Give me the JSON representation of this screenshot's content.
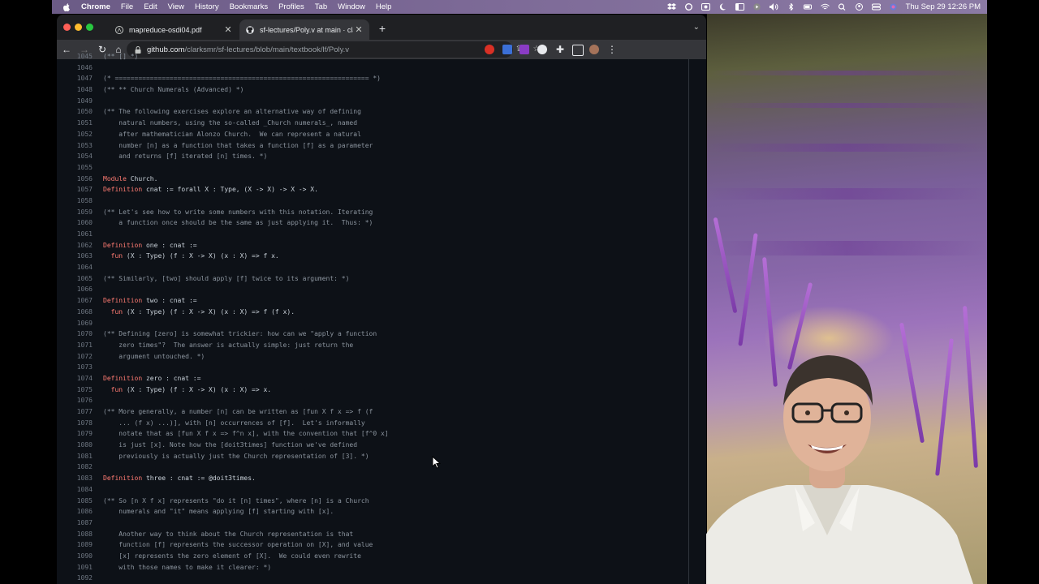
{
  "menubar": {
    "app": "Chrome",
    "items": [
      "File",
      "Edit",
      "View",
      "History",
      "Bookmarks",
      "Profiles",
      "Tab",
      "Window",
      "Help"
    ],
    "clock": "Thu Sep 29  12:26 PM"
  },
  "tabs": [
    {
      "title": "mapreduce-osdi04.pdf",
      "icon": "pdf-icon"
    },
    {
      "title": "sf-lectures/Poly.v at main · cla",
      "icon": "github-icon"
    }
  ],
  "address": {
    "host": "github.com",
    "path": "/clarksmr/sf-lectures/blob/main/textbook/lf/Poly.v"
  },
  "code": {
    "lines": [
      {
        "n": "1045",
        "t": "(** [] *)",
        "c": true
      },
      {
        "n": "1046",
        "t": ""
      },
      {
        "n": "1047",
        "t": "(* ================================================================= *)",
        "c": true
      },
      {
        "n": "1048",
        "t": "(** ** Church Numerals (Advanced) *)",
        "c": true
      },
      {
        "n": "1049",
        "t": ""
      },
      {
        "n": "1050",
        "t": "(** The following exercises explore an alternative way of defining",
        "c": true
      },
      {
        "n": "1051",
        "t": "    natural numbers, using the so-called _Church numerals_, named",
        "c": true
      },
      {
        "n": "1052",
        "t": "    after mathematician Alonzo Church.  We can represent a natural",
        "c": true
      },
      {
        "n": "1053",
        "t": "    number [n] as a function that takes a function [f] as a parameter",
        "c": true
      },
      {
        "n": "1054",
        "t": "    and returns [f] iterated [n] times. *)",
        "c": true
      },
      {
        "n": "1055",
        "t": ""
      },
      {
        "n": "1056",
        "k": "Module",
        "t": " Church."
      },
      {
        "n": "1057",
        "k": "Definition",
        "t": " cnat := forall X : Type, (X -> X) -> X -> X."
      },
      {
        "n": "1058",
        "t": ""
      },
      {
        "n": "1059",
        "t": "(** Let's see how to write some numbers with this notation. Iterating",
        "c": true
      },
      {
        "n": "1060",
        "t": "    a function once should be the same as just applying it.  Thus: *)",
        "c": true
      },
      {
        "n": "1061",
        "t": ""
      },
      {
        "n": "1062",
        "k": "Definition",
        "t": " one : cnat :="
      },
      {
        "n": "1063",
        "p": "  ",
        "k": "fun",
        "t": " (X : Type) (f : X -> X) (x : X) => f x."
      },
      {
        "n": "1064",
        "t": ""
      },
      {
        "n": "1065",
        "t": "(** Similarly, [two] should apply [f] twice to its argument: *)",
        "c": true
      },
      {
        "n": "1066",
        "t": ""
      },
      {
        "n": "1067",
        "k": "Definition",
        "t": " two : cnat :="
      },
      {
        "n": "1068",
        "p": "  ",
        "k": "fun",
        "t": " (X : Type) (f : X -> X) (x : X) => f (f x)."
      },
      {
        "n": "1069",
        "t": ""
      },
      {
        "n": "1070",
        "t": "(** Defining [zero] is somewhat trickier: how can we \"apply a function",
        "c": true
      },
      {
        "n": "1071",
        "t": "    zero times\"?  The answer is actually simple: just return the",
        "c": true
      },
      {
        "n": "1072",
        "t": "    argument untouched. *)",
        "c": true
      },
      {
        "n": "1073",
        "t": ""
      },
      {
        "n": "1074",
        "k": "Definition",
        "t": " zero : cnat :="
      },
      {
        "n": "1075",
        "p": "  ",
        "k": "fun",
        "t": " (X : Type) (f : X -> X) (x : X) => x."
      },
      {
        "n": "1076",
        "t": ""
      },
      {
        "n": "1077",
        "t": "(** More generally, a number [n] can be written as [fun X f x => f (f",
        "c": true
      },
      {
        "n": "1078",
        "t": "    ... (f x) ...)], with [n] occurrences of [f].  Let's informally",
        "c": true
      },
      {
        "n": "1079",
        "t": "    notate that as [fun X f x => f^n x], with the convention that [f^0 x]",
        "c": true
      },
      {
        "n": "1080",
        "t": "    is just [x]. Note how the [doit3times] function we've defined",
        "c": true
      },
      {
        "n": "1081",
        "t": "    previously is actually just the Church representation of [3]. *)",
        "c": true
      },
      {
        "n": "1082",
        "t": ""
      },
      {
        "n": "1083",
        "k": "Definition",
        "t": " three : cnat := @doit3times."
      },
      {
        "n": "1084",
        "t": ""
      },
      {
        "n": "1085",
        "t": "(** So [n X f x] represents \"do it [n] times\", where [n] is a Church",
        "c": true
      },
      {
        "n": "1086",
        "t": "    numerals and \"it\" means applying [f] starting with [x].",
        "c": true
      },
      {
        "n": "1087",
        "t": ""
      },
      {
        "n": "1088",
        "t": "    Another way to think about the Church representation is that",
        "c": true
      },
      {
        "n": "1089",
        "t": "    function [f] represents the successor operation on [X], and value",
        "c": true
      },
      {
        "n": "1090",
        "t": "    [x] represents the zero element of [X].  We could even rewrite",
        "c": true
      },
      {
        "n": "1091",
        "t": "    with those names to make it clearer: *)",
        "c": true
      },
      {
        "n": "1092",
        "t": ""
      }
    ]
  }
}
